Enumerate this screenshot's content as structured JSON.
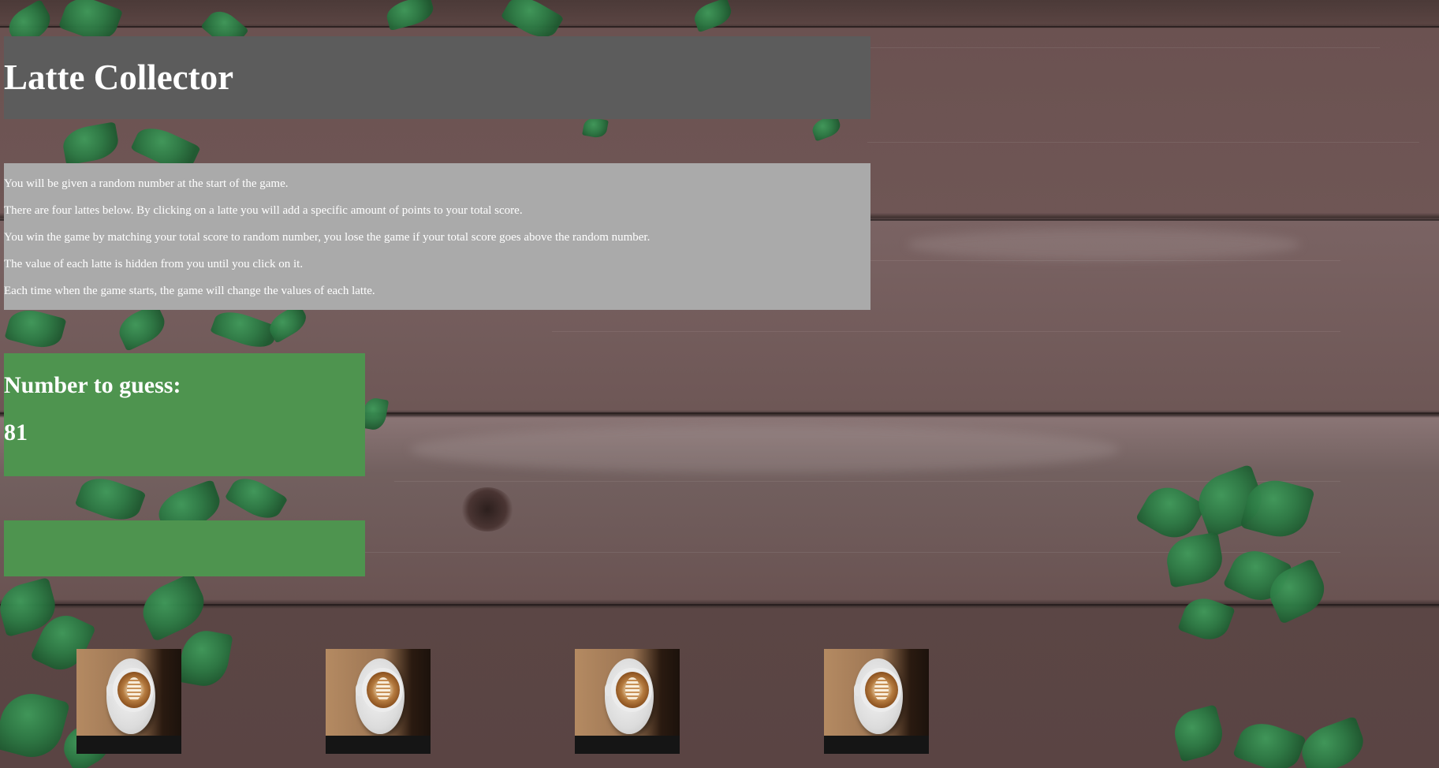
{
  "game": {
    "title": "Latte Collector",
    "instructions": [
      "You will be given a random number at the start of the game.",
      "There are four lattes below. By clicking on a latte you will add a specific amount of points to your total score.",
      "You win the game by matching your total score to random number, you lose the game if your total score goes above the random number.",
      "The value of each latte is hidden from you until you click on it.",
      "Each time when the game starts, the game will change the values of each latte."
    ],
    "guess_label": "Number to guess:",
    "guess_number": "81",
    "score_value": ""
  },
  "lattes": [
    {
      "icon": "latte-icon"
    },
    {
      "icon": "latte-icon"
    },
    {
      "icon": "latte-icon"
    },
    {
      "icon": "latte-icon"
    }
  ],
  "colors": {
    "title_bg": "#5c5c5c",
    "instructions_bg": "#aaaaaa",
    "guess_bg": "#4e944f",
    "text": "#ffffff"
  }
}
